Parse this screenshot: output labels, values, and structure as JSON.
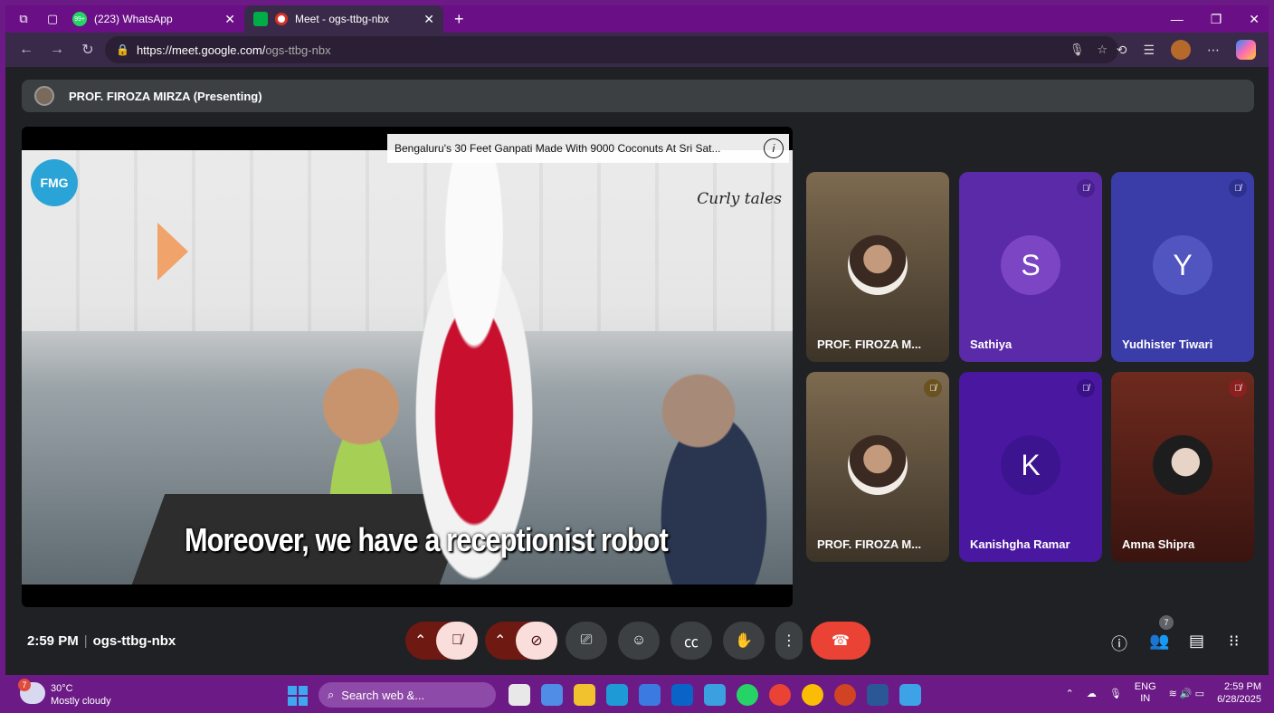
{
  "browser": {
    "tabs": [
      {
        "label": "(223) WhatsApp",
        "favicon_count": "99+",
        "active": false
      },
      {
        "label": "Meet - ogs-ttbg-nbx",
        "active": true
      }
    ],
    "url_host": "https://meet.google.com/",
    "url_path": "ogs-ttbg-nbx"
  },
  "meet": {
    "presenter_banner": "PROF. FIROZA MIRZA (Presenting)",
    "video": {
      "title": "Bengaluru's 30 Feet Ganpati Made With 9000 Coconuts At Sri Sat...",
      "logo": "FMG",
      "brand": "Curly tales",
      "caption": "Moreover, we have a receptionist robot"
    },
    "participants": [
      {
        "name": "PROF. FIROZA M...",
        "avatar": "photo",
        "muted": false
      },
      {
        "name": "Sathiya",
        "initial": "S",
        "muted": true
      },
      {
        "name": "Yudhister Tiwari",
        "initial": "Y",
        "muted": true
      },
      {
        "name": "PROF. FIROZA M...",
        "avatar": "photo",
        "muted": true
      },
      {
        "name": "Kanishgha Ramar",
        "initial": "K",
        "muted": true
      },
      {
        "name": "Amna Shipra",
        "avatar": "photo",
        "muted": true
      }
    ],
    "time": "2:59 PM",
    "meeting_code": "ogs-ttbg-nbx",
    "people_count": "7",
    "colors": {
      "end_call": "#ea4335",
      "muted_bg": "#f9dedc",
      "tile_purple": "#5b2aa8"
    }
  },
  "taskbar": {
    "weather_temp": "30°C",
    "weather_desc": "Mostly cloudy",
    "weather_badge": "7",
    "search_placeholder": "Search web &...",
    "lang_top": "ENG",
    "lang_bottom": "IN",
    "clock_time": "2:59 PM",
    "clock_date": "6/28/2025"
  }
}
